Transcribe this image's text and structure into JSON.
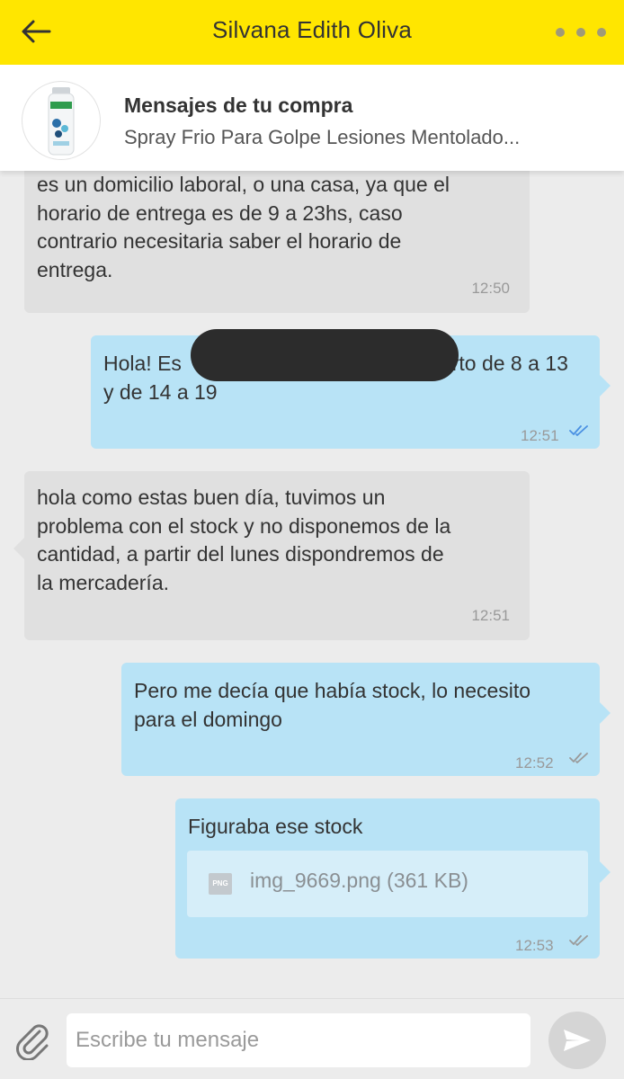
{
  "header": {
    "back_icon": "arrow-left-icon",
    "title": "Silvana Edith Oliva",
    "more_icon": "more-dots-icon",
    "bar_color": "#ffe600"
  },
  "purchase": {
    "title": "Mensajes de tu compra",
    "subtitle": "Spray Frio Para Golpe Lesiones Mentolado..."
  },
  "messages": [
    {
      "direction": "incoming",
      "lines": [
        "es un domicilio laboral, o una casa, ya que el",
        "horario de entrega es de 9 a 23hs, caso",
        "contrario necesitaria saber el horario de",
        "entrega."
      ],
      "time": "12:50"
    },
    {
      "direction": "outgoing",
      "lines": [
        "Hola! Es",
        "erto de 8 a 13",
        "y de 14 a 19"
      ],
      "time": "12:51",
      "status": "read"
    },
    {
      "direction": "incoming",
      "lines": [
        "hola como estas buen día, tuvimos un",
        "problema con el stock y no disponemos de la",
        "cantidad, a partir del lunes dispondremos de",
        "la mercadería."
      ],
      "time": "12:51"
    },
    {
      "direction": "outgoing",
      "lines": [
        "Pero me decía que había stock, lo necesito",
        "para el domingo"
      ],
      "time": "12:52",
      "status": "delivered"
    },
    {
      "direction": "outgoing",
      "lines": [
        "Figuraba ese stock"
      ],
      "attachment": {
        "type_label": "PNG",
        "name": "img_9669.png (361 KB)"
      },
      "time": "12:53",
      "status": "delivered"
    }
  ],
  "input": {
    "placeholder": "Escribe tu mensaje",
    "attach_icon": "paperclip-icon",
    "send_icon": "send-icon"
  },
  "colors": {
    "incoming_bubble": "#e0e0e0",
    "outgoing_bubble": "#b8e3f6",
    "read_check": "#4a90e2",
    "delivered_check": "#9a9a9a"
  }
}
